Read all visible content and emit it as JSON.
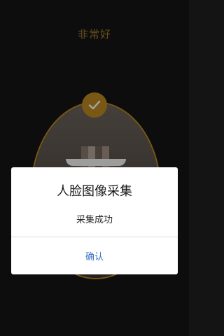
{
  "screen": {
    "status_text": "非常好"
  },
  "icons": {
    "success": "checkmark-icon"
  },
  "dialog": {
    "title": "人脸图像采集",
    "message": "采集成功",
    "confirm_label": "确认"
  },
  "colors": {
    "accent_gold": "#b8871f",
    "status_text": "#a27a2a",
    "background": "#141414",
    "link_blue": "#3b6fc4"
  }
}
